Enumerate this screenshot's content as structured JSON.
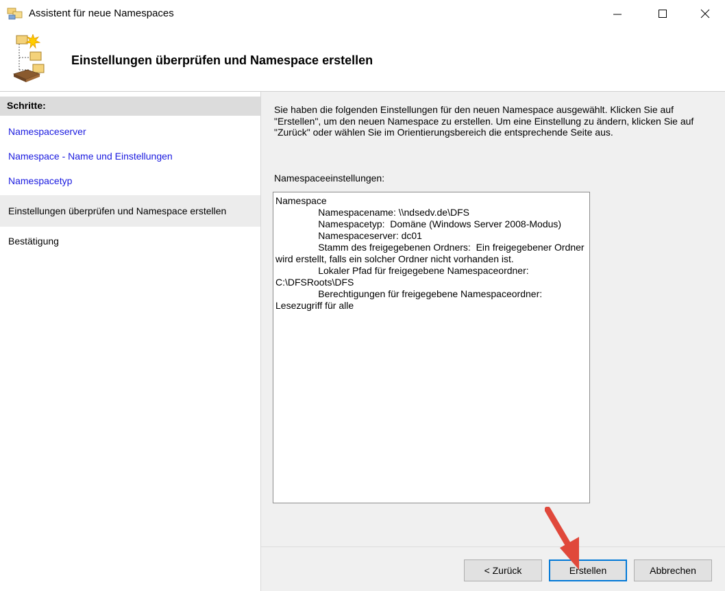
{
  "window": {
    "title": "Assistent für neue Namespaces",
    "controls": {
      "minimize": "—",
      "maximize": "☐",
      "close": "✕"
    }
  },
  "header": {
    "heading": "Einstellungen überprüfen und Namespace erstellen",
    "icon": "namespace-wizard-icon"
  },
  "sidebar": {
    "title": "Schritte:",
    "steps": [
      {
        "label": "Namespaceserver",
        "state": "link"
      },
      {
        "label": "Namespace - Name und Einstellungen",
        "state": "link"
      },
      {
        "label": "Namespacetyp",
        "state": "link"
      },
      {
        "label": "Einstellungen überprüfen und Namespace erstellen",
        "state": "current"
      },
      {
        "label": "Bestätigung",
        "state": "plain"
      }
    ]
  },
  "main": {
    "description": "Sie haben die folgenden Einstellungen für den neuen Namespace ausgewählt. Klicken Sie auf \"Erstellen\", um den neuen Namespace zu erstellen. Um eine Einstellung zu ändern, klicken Sie auf \"Zurück\" oder wählen Sie im Orientierungsbereich die entsprechende Seite aus.",
    "settings_label": "Namespaceeinstellungen:",
    "settings_text": "Namespace\n\t\tNamespacename: \\\\ndsedv.de\\DFS\n\t\tNamespacetyp:  Domäne (Windows Server 2008-Modus)\n\t\tNamespaceserver: dc01\n\t\tStamm des freigegebenen Ordners:  Ein freigegebener Ordner wird erstellt, falls ein solcher Ordner nicht vorhanden ist.\n\t\tLokaler Pfad für freigegebene Namespaceordner: C:\\DFSRoots\\DFS\n\t\tBerechtigungen für freigegebene Namespaceordner: Lesezugriff für alle"
  },
  "buttons": {
    "back": "< Zurück",
    "create": "Erstellen",
    "cancel": "Abbrechen"
  },
  "colors": {
    "link": "#1a1adf",
    "focus_border": "#0078d7",
    "arrow": "#e0483b"
  }
}
